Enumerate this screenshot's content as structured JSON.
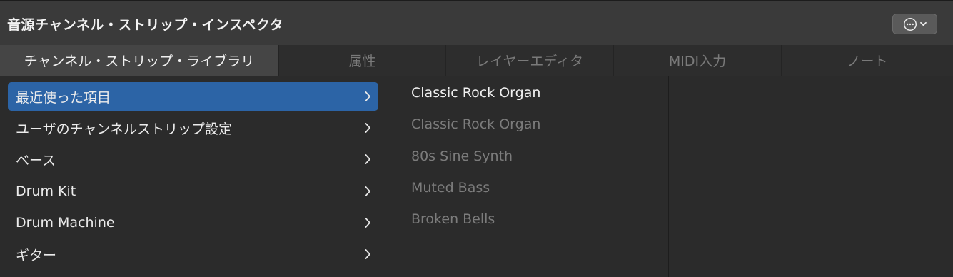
{
  "header": {
    "title": "音源チャンネル・ストリップ・インスペクタ",
    "action_icon": "ellipsis-circle-icon"
  },
  "tabs": [
    {
      "label": "チャンネル・ストリップ・ライブラリ",
      "active": true
    },
    {
      "label": "属性",
      "active": false
    },
    {
      "label": "レイヤーエディタ",
      "active": false
    },
    {
      "label": "MIDI入力",
      "active": false
    },
    {
      "label": "ノート",
      "active": false
    }
  ],
  "categories": [
    {
      "label": "最近使った項目",
      "selected": true
    },
    {
      "label": "ユーザのチャンネルストリップ設定",
      "selected": false
    },
    {
      "label": "ベース",
      "selected": false
    },
    {
      "label": "Drum Kit",
      "selected": false
    },
    {
      "label": "Drum Machine",
      "selected": false
    },
    {
      "label": "ギター",
      "selected": false
    }
  ],
  "recent_items": [
    {
      "label": "Classic Rock Organ",
      "current": true
    },
    {
      "label": "Classic Rock Organ",
      "current": false
    },
    {
      "label": "80s Sine Synth",
      "current": false
    },
    {
      "label": "Muted Bass",
      "current": false
    },
    {
      "label": "Broken Bells",
      "current": false
    }
  ],
  "colors": {
    "selection": "#2c64a6",
    "background": "#2b2b2b",
    "titlebar": "#3a3a3a"
  }
}
